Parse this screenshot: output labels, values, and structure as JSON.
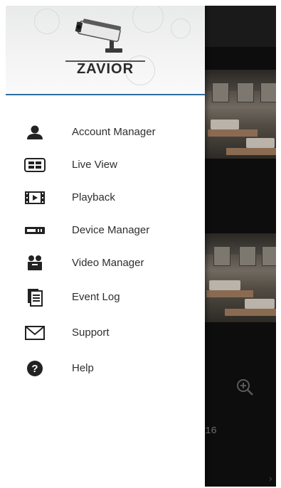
{
  "drawer": {
    "brand": "ZAVIOR",
    "menu": [
      {
        "label": "Account Manager",
        "icon": "person-icon"
      },
      {
        "label": "Live View",
        "icon": "grid-icon"
      },
      {
        "label": "Playback",
        "icon": "film-icon"
      },
      {
        "label": "Device Manager",
        "icon": "dvr-icon"
      },
      {
        "label": "Video Manager",
        "icon": "video-camera-icon"
      },
      {
        "label": "Event Log",
        "icon": "document-icon"
      },
      {
        "label": "Support",
        "icon": "envelope-icon"
      },
      {
        "label": "Help",
        "icon": "question-icon"
      }
    ]
  },
  "background": {
    "channel_text": "16"
  },
  "colors": {
    "header_rule": "#2f6d9c",
    "icon": "#222222",
    "text": "#2e2e2e"
  }
}
